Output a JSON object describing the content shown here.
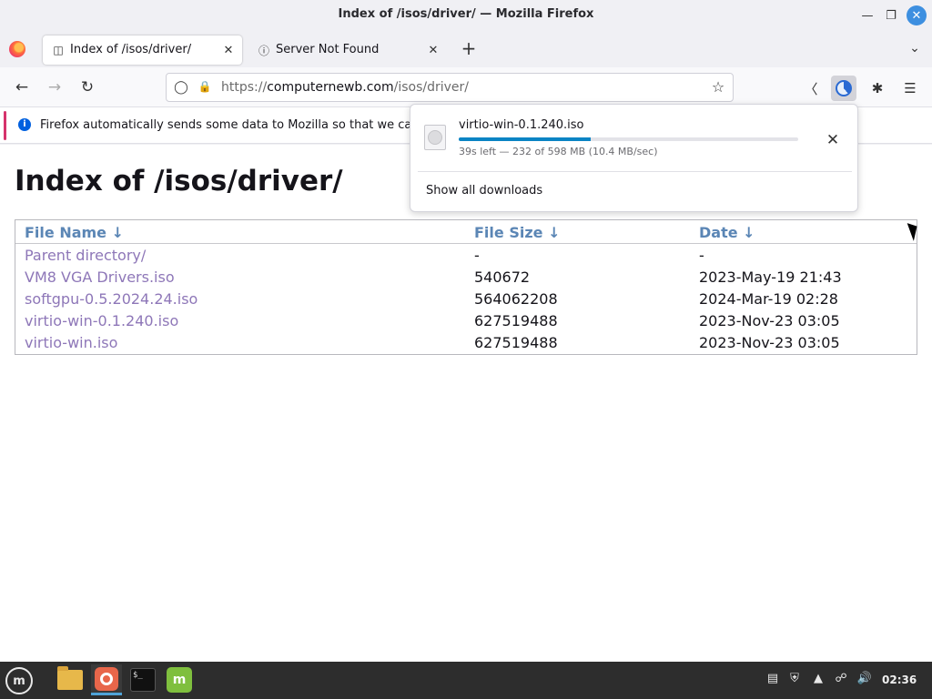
{
  "window": {
    "title": "Index of /isos/driver/ — Mozilla Firefox"
  },
  "tabs": [
    {
      "label": "Index of /isos/driver/",
      "active": true
    },
    {
      "label": "Server Not Found",
      "active": false
    }
  ],
  "address_bar": {
    "scheme": "https://",
    "host": "computernewb.com",
    "path": "/isos/driver/"
  },
  "notification": {
    "text": "Firefox automatically sends some data to Mozilla so that we can improve your experience."
  },
  "page": {
    "heading": "Index of /isos/driver/",
    "columns": [
      "File Name  ↓",
      "File Size  ↓",
      "Date  ↓"
    ],
    "rows": [
      {
        "name": "Parent directory/",
        "size": "-",
        "date": "-"
      },
      {
        "name": "VM8 VGA Drivers.iso",
        "size": "540672",
        "date": "2023-May-19 21:43"
      },
      {
        "name": "softgpu-0.5.2024.24.iso",
        "size": "564062208",
        "date": "2024-Mar-19 02:28"
      },
      {
        "name": "virtio-win-0.1.240.iso",
        "size": "627519488",
        "date": "2023-Nov-23 03:05"
      },
      {
        "name": "virtio-win.iso",
        "size": "627519488",
        "date": "2023-Nov-23 03:05"
      }
    ]
  },
  "downloads_panel": {
    "filename": "virtio-win-0.1.240.iso",
    "status": "39s left — 232 of 598 MB (10.4 MB/sec)",
    "progress_percent": 38.8,
    "show_all_label": "Show all downloads"
  },
  "taskbar": {
    "clock": "02:36"
  },
  "colors": {
    "link": "#8e77b8",
    "header_link": "#5b86b5",
    "progress": "#0a84c4",
    "accent": "#0060df"
  }
}
